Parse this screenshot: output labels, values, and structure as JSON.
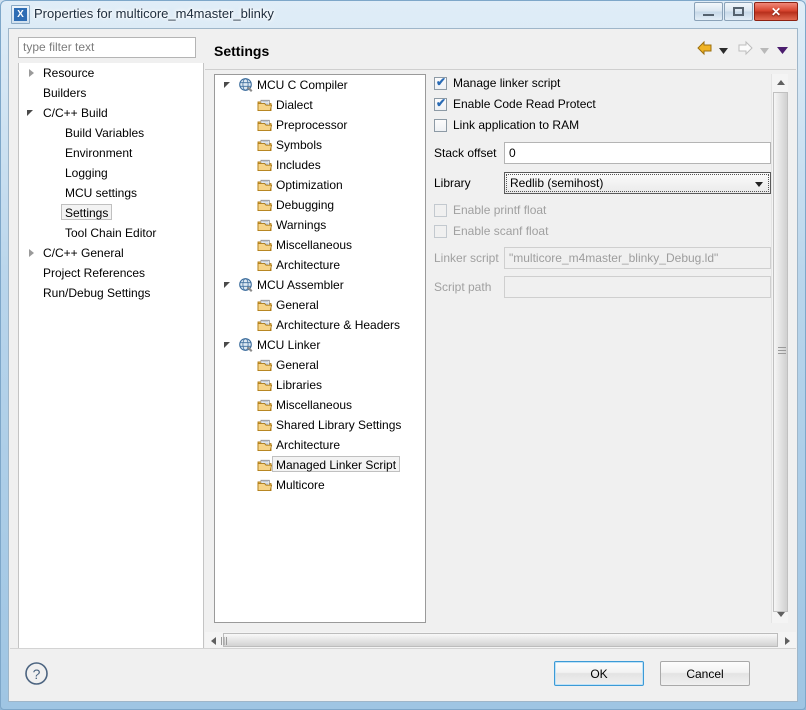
{
  "window": {
    "title": "Properties for multicore_m4master_blinky",
    "icon": "app-x-icon",
    "minimize_label": "Minimize",
    "maximize_label": "Maximize",
    "close_label": "Close"
  },
  "filter": {
    "placeholder": "type filter text",
    "value": ""
  },
  "sidebar": {
    "items": [
      {
        "label": "Resource",
        "indent": 0,
        "expander": "collapsed",
        "selected": false
      },
      {
        "label": "Builders",
        "indent": 0,
        "expander": "none",
        "selected": false
      },
      {
        "label": "C/C++ Build",
        "indent": 0,
        "expander": "expanded",
        "selected": false
      },
      {
        "label": "Build Variables",
        "indent": 1,
        "expander": "none",
        "selected": false
      },
      {
        "label": "Environment",
        "indent": 1,
        "expander": "none",
        "selected": false
      },
      {
        "label": "Logging",
        "indent": 1,
        "expander": "none",
        "selected": false
      },
      {
        "label": "MCU settings",
        "indent": 1,
        "expander": "none",
        "selected": false
      },
      {
        "label": "Settings",
        "indent": 1,
        "expander": "none",
        "selected": true
      },
      {
        "label": "Tool Chain Editor",
        "indent": 1,
        "expander": "none",
        "selected": false
      },
      {
        "label": "C/C++ General",
        "indent": 0,
        "expander": "collapsed",
        "selected": false
      },
      {
        "label": "Project References",
        "indent": 0,
        "expander": "none",
        "selected": false
      },
      {
        "label": "Run/Debug Settings",
        "indent": 0,
        "expander": "none",
        "selected": false
      }
    ]
  },
  "header": {
    "title": "Settings",
    "back_icon": "back-arrow-icon",
    "back_dropdown_icon": "chevron-down-icon",
    "forward_icon": "forward-arrow-icon",
    "forward_dropdown_icon": "chevron-down-icon",
    "menu_icon": "view-menu-icon"
  },
  "settings_tree": {
    "items": [
      {
        "label": "MCU C Compiler",
        "indent": 0,
        "expander": "expanded",
        "icon": "tool-globe-icon",
        "selected": false
      },
      {
        "label": "Dialect",
        "indent": 1,
        "expander": "none",
        "icon": "folder-page-icon",
        "selected": false
      },
      {
        "label": "Preprocessor",
        "indent": 1,
        "expander": "none",
        "icon": "folder-page-icon",
        "selected": false
      },
      {
        "label": "Symbols",
        "indent": 1,
        "expander": "none",
        "icon": "folder-page-icon",
        "selected": false
      },
      {
        "label": "Includes",
        "indent": 1,
        "expander": "none",
        "icon": "folder-page-icon",
        "selected": false
      },
      {
        "label": "Optimization",
        "indent": 1,
        "expander": "none",
        "icon": "folder-page-icon",
        "selected": false
      },
      {
        "label": "Debugging",
        "indent": 1,
        "expander": "none",
        "icon": "folder-page-icon",
        "selected": false
      },
      {
        "label": "Warnings",
        "indent": 1,
        "expander": "none",
        "icon": "folder-page-icon",
        "selected": false
      },
      {
        "label": "Miscellaneous",
        "indent": 1,
        "expander": "none",
        "icon": "folder-page-icon",
        "selected": false
      },
      {
        "label": "Architecture",
        "indent": 1,
        "expander": "none",
        "icon": "folder-page-icon",
        "selected": false
      },
      {
        "label": "MCU Assembler",
        "indent": 0,
        "expander": "expanded",
        "icon": "tool-globe-icon",
        "selected": false
      },
      {
        "label": "General",
        "indent": 1,
        "expander": "none",
        "icon": "folder-page-icon",
        "selected": false
      },
      {
        "label": "Architecture & Headers",
        "indent": 1,
        "expander": "none",
        "icon": "folder-page-icon",
        "selected": false
      },
      {
        "label": "MCU Linker",
        "indent": 0,
        "expander": "expanded",
        "icon": "tool-globe-icon",
        "selected": false
      },
      {
        "label": "General",
        "indent": 1,
        "expander": "none",
        "icon": "folder-page-icon",
        "selected": false
      },
      {
        "label": "Libraries",
        "indent": 1,
        "expander": "none",
        "icon": "folder-page-icon",
        "selected": false
      },
      {
        "label": "Miscellaneous",
        "indent": 1,
        "expander": "none",
        "icon": "folder-page-icon",
        "selected": false
      },
      {
        "label": "Shared Library Settings",
        "indent": 1,
        "expander": "none",
        "icon": "folder-page-icon",
        "selected": false
      },
      {
        "label": "Architecture",
        "indent": 1,
        "expander": "none",
        "icon": "folder-page-icon",
        "selected": false
      },
      {
        "label": "Managed Linker Script",
        "indent": 1,
        "expander": "none",
        "icon": "folder-page-icon",
        "selected": true
      },
      {
        "label": "Multicore",
        "indent": 1,
        "expander": "none",
        "icon": "folder-page-icon",
        "selected": false
      }
    ]
  },
  "form": {
    "checkboxes": [
      {
        "label": "Manage linker script",
        "checked": true,
        "enabled": true
      },
      {
        "label": "Enable Code Read Protect",
        "checked": true,
        "enabled": true
      },
      {
        "label": "Link application to RAM",
        "checked": false,
        "enabled": true
      }
    ],
    "stack_offset": {
      "label": "Stack offset",
      "value": "0",
      "enabled": true
    },
    "library": {
      "label": "Library",
      "value": "Redlib (semihost)",
      "enabled": true,
      "focused": true,
      "dropdown_icon": "chevron-down-icon"
    },
    "float_checkboxes": [
      {
        "label": "Enable printf float",
        "checked": false,
        "enabled": false
      },
      {
        "label": "Enable scanf float",
        "checked": false,
        "enabled": false
      }
    ],
    "linker_script": {
      "label": "Linker script",
      "value": "\"multicore_m4master_blinky_Debug.ld\"",
      "enabled": false
    },
    "script_path": {
      "label": "Script path",
      "value": "",
      "enabled": false
    }
  },
  "scrollbars": {
    "vertical_up_icon": "triangle-up-icon",
    "vertical_down_icon": "triangle-down-icon",
    "horizontal_left_icon": "triangle-left-icon",
    "horizontal_right_icon": "triangle-right-icon"
  },
  "footer": {
    "help_icon": "help-question-icon",
    "ok_label": "OK",
    "cancel_label": "Cancel"
  },
  "colors": {
    "accent": "#3c9ad6",
    "checkmark": "#2a6bb5",
    "disabled_text": "#a0a0a0",
    "dialog_bg": "#f0f0f0",
    "close_button": "#d7452f"
  }
}
